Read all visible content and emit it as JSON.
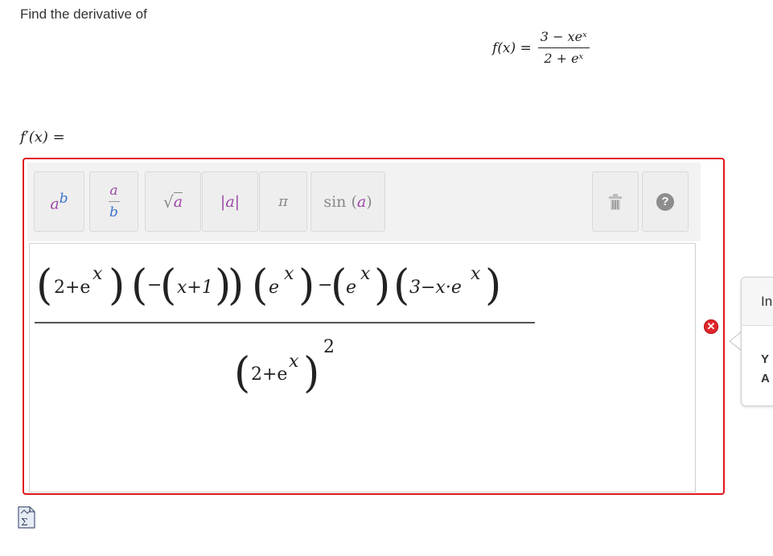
{
  "prompt": "Find the derivative of",
  "given": {
    "lhs": "f(x) =",
    "numerator": "3 − xeˣ",
    "denominator": "2 + eˣ"
  },
  "answer_label": "f′(x) =",
  "toolbar": {
    "power": {
      "base": "a",
      "exp": "b"
    },
    "fraction": {
      "top": "a",
      "bottom": "b"
    },
    "sqrt": "a",
    "abs": "|a|",
    "pi": "π",
    "sin": {
      "fn": "sin",
      "arg": "a"
    }
  },
  "expression": {
    "f1": "2+e",
    "x": "x",
    "f2": "x+1",
    "neg": "−",
    "e": "e",
    "minus": "−",
    "f5": "3−x·e",
    "den": "2+e",
    "pow": "2"
  },
  "popover": {
    "heading": "In",
    "line1": "Y",
    "line2": "A"
  },
  "icons": [
    "trash-icon",
    "help-icon",
    "error-icon",
    "sigma-icon"
  ],
  "colors": {
    "error_border": "#e0151d",
    "purple": "#9b46a6",
    "blue": "#3a73c9"
  }
}
